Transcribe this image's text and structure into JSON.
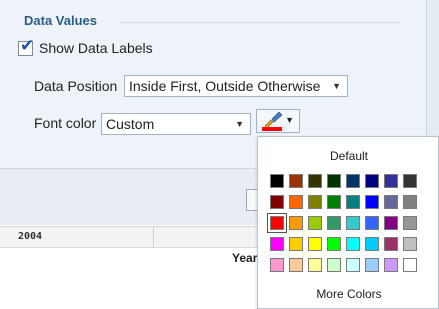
{
  "section": {
    "title": "Data Values"
  },
  "show_labels": {
    "label": "Show Data Labels",
    "checked": true
  },
  "data_position": {
    "label": "Data Position",
    "value": "Inside First, Outside Otherwise"
  },
  "font_color": {
    "label": "Font color",
    "value": "Custom",
    "current_color": "#ff0000",
    "button_icon": "paintbrush-icon"
  },
  "table": {
    "row_value": "2004",
    "column_header": "Year"
  },
  "color_picker": {
    "default_label": "Default",
    "more_label": "More Colors",
    "selected_color": "#ff0000",
    "rows": [
      [
        "#000000",
        "#993300",
        "#333300",
        "#003300",
        "#003366",
        "#000080",
        "#333399",
        "#333333"
      ],
      [
        "#800000",
        "#ff6600",
        "#808000",
        "#008000",
        "#008080",
        "#0000ff",
        "#666699",
        "#808080"
      ],
      [
        "#ff0000",
        "#ff9900",
        "#99cc00",
        "#339966",
        "#33cccc",
        "#3366ff",
        "#800080",
        "#969696"
      ],
      [
        "#ff00ff",
        "#ffcc00",
        "#ffff00",
        "#00ff00",
        "#00ffff",
        "#00ccff",
        "#993366",
        "#c0c0c0"
      ],
      [
        "#ff99cc",
        "#ffcc99",
        "#ffff99",
        "#ccffcc",
        "#ccffff",
        "#99ccff",
        "#cc99ff",
        "#ffffff"
      ]
    ]
  }
}
